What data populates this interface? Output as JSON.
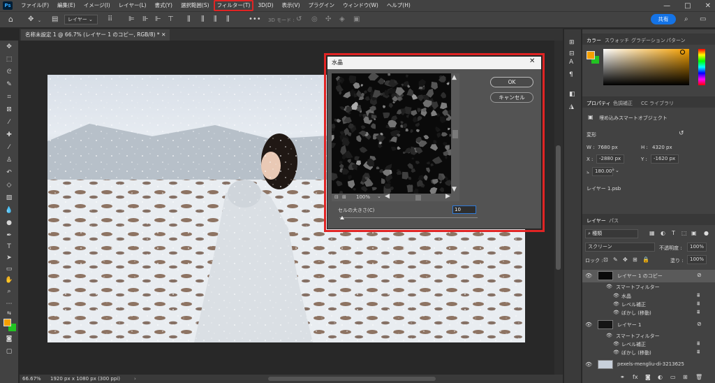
{
  "menu": {
    "app": "Ps",
    "items": [
      "ファイル(F)",
      "編集(E)",
      "イメージ(I)",
      "レイヤー(L)",
      "書式(Y)",
      "選択範囲(S)",
      "フィルター(T)",
      "3D(D)",
      "表示(V)",
      "プラグイン",
      "ウィンドウ(W)",
      "ヘルプ(H)"
    ]
  },
  "window": {
    "min": "—",
    "max": "□",
    "close": "✕"
  },
  "options": {
    "layer_dropdown": "レイヤー",
    "mode3d": "3D モード :",
    "share": "共有"
  },
  "document": {
    "tab": "名称未設定 1 @ 66.7% (レイヤー 1 のコピー, RGB/8) *",
    "zoom": "66.67%",
    "size": "1920 px x 1080 px (300 ppi)"
  },
  "dialog": {
    "title": "水晶",
    "ok": "OK",
    "cancel": "キャンセル",
    "preview_zoom": "100%",
    "cell_label": "セルの大きさ(C)",
    "cell_value": "10",
    "cell_value_fraction": 0.02
  },
  "color_panel": {
    "tabs": [
      "カラー",
      "スウォッチ",
      "グラデーション",
      "パターン"
    ],
    "fg": "#f5a000",
    "bg": "#22c322"
  },
  "properties": {
    "tabs": [
      "プロパティ",
      "色調補正",
      "CC ライブラリ"
    ],
    "object_type": "埋め込みスマートオブジェクト",
    "transform_label": "変形",
    "w_label": "W :",
    "w": "7680 px",
    "h_label": "H :",
    "h": "4320 px",
    "x_label": "X :",
    "x": "-2880 px",
    "y_label": "Y :",
    "y": "-1620 px",
    "angle": "180.00°",
    "link": "レイヤー 1.psb"
  },
  "layers": {
    "tabs": [
      "レイヤー",
      "パス"
    ],
    "kind": "種類",
    "blend": "スクリーン",
    "opacity_label": "不透明度 :",
    "opacity": "100%",
    "lock_label": "ロック :",
    "fill_label": "塗り :",
    "fill": "100%",
    "items": [
      {
        "name": "レイヤー 1 のコピー",
        "kind": "layer"
      },
      {
        "name": "スマートフィルター",
        "kind": "smart"
      },
      {
        "name": "水晶",
        "kind": "filter"
      },
      {
        "name": "レベル補正",
        "kind": "filter"
      },
      {
        "name": "ぼかし (移動)",
        "kind": "filter"
      },
      {
        "name": "レイヤー 1",
        "kind": "layer"
      },
      {
        "name": "スマートフィルター",
        "kind": "smart"
      },
      {
        "name": "レベル補正",
        "kind": "filter"
      },
      {
        "name": "ぼかし (移動)",
        "kind": "filter"
      },
      {
        "name": "pexels-mengliu-di-3213625",
        "kind": "layer"
      }
    ]
  },
  "tool_colors": {
    "fg": "#f5a000",
    "bg": "#22c322"
  }
}
